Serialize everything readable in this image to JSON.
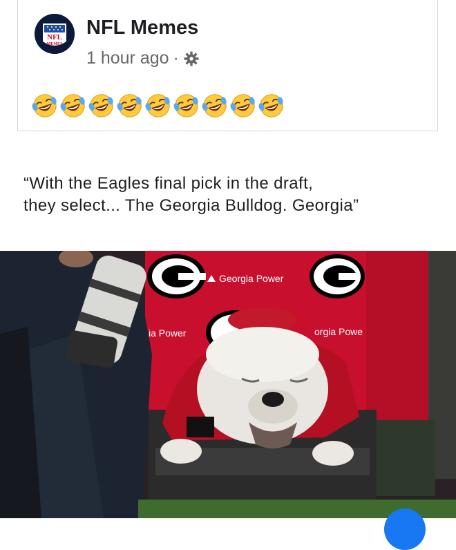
{
  "post": {
    "author": "NFL Memes",
    "timestamp": "1 hour ago",
    "separator": "·",
    "privacy_icon": "gear-icon",
    "avatar_logo_text": "NFL",
    "avatar_logo_subtext": "MEMES",
    "reactions_emoji": "face-with-tears-of-joy",
    "reactions_count": 9
  },
  "caption": {
    "text": "“With the Eagles final pick in the draft,\nthey select... The Georgia Bulldog. Georgia”"
  },
  "photo": {
    "banner_top": "Georgia Power",
    "banner_left": "ia Power",
    "banner_right": "orgia Powe"
  },
  "colors": {
    "accent": "#1877f2",
    "georgia_red": "#c8102e",
    "text_primary": "#1c1e21",
    "text_secondary": "#65676b"
  }
}
